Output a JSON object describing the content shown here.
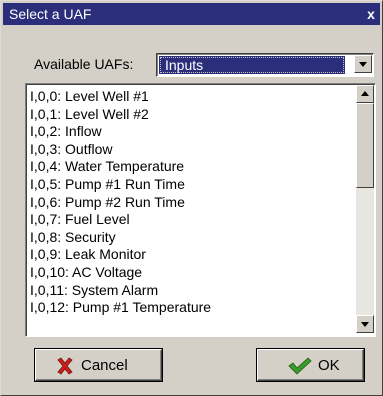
{
  "window": {
    "title": "Select a UAF",
    "close_glyph": "x"
  },
  "form": {
    "uaf_label": "Available UAFs:",
    "selected_uaf": "Inputs"
  },
  "list": {
    "items": [
      "I,0,0: Level Well #1",
      "I,0,1: Level Well #2",
      "I,0,2: Inflow",
      "I,0,3: Outflow",
      "I,0,4: Water Temperature",
      "I,0,5: Pump #1 Run Time",
      "I,0,6: Pump #2 Run Time",
      "I,0,7: Fuel Level",
      "I,0,8: Security",
      "I,0,9: Leak Monitor",
      "I,0,10: AC Voltage",
      "I,0,11: System Alarm",
      "I,0,12: Pump #1 Temperature"
    ],
    "scroll_position": 0
  },
  "buttons": {
    "cancel_label": "Cancel",
    "ok_label": "OK"
  },
  "icons": {
    "cancel": "red-x-icon",
    "ok": "green-checkmark-icon"
  },
  "colors": {
    "titlebar": "#2b2e7a",
    "selection": "#2b2e7a",
    "face": "#d4d0c8",
    "cancel_icon": "#c8201c",
    "ok_icon": "#3a9a2a"
  }
}
